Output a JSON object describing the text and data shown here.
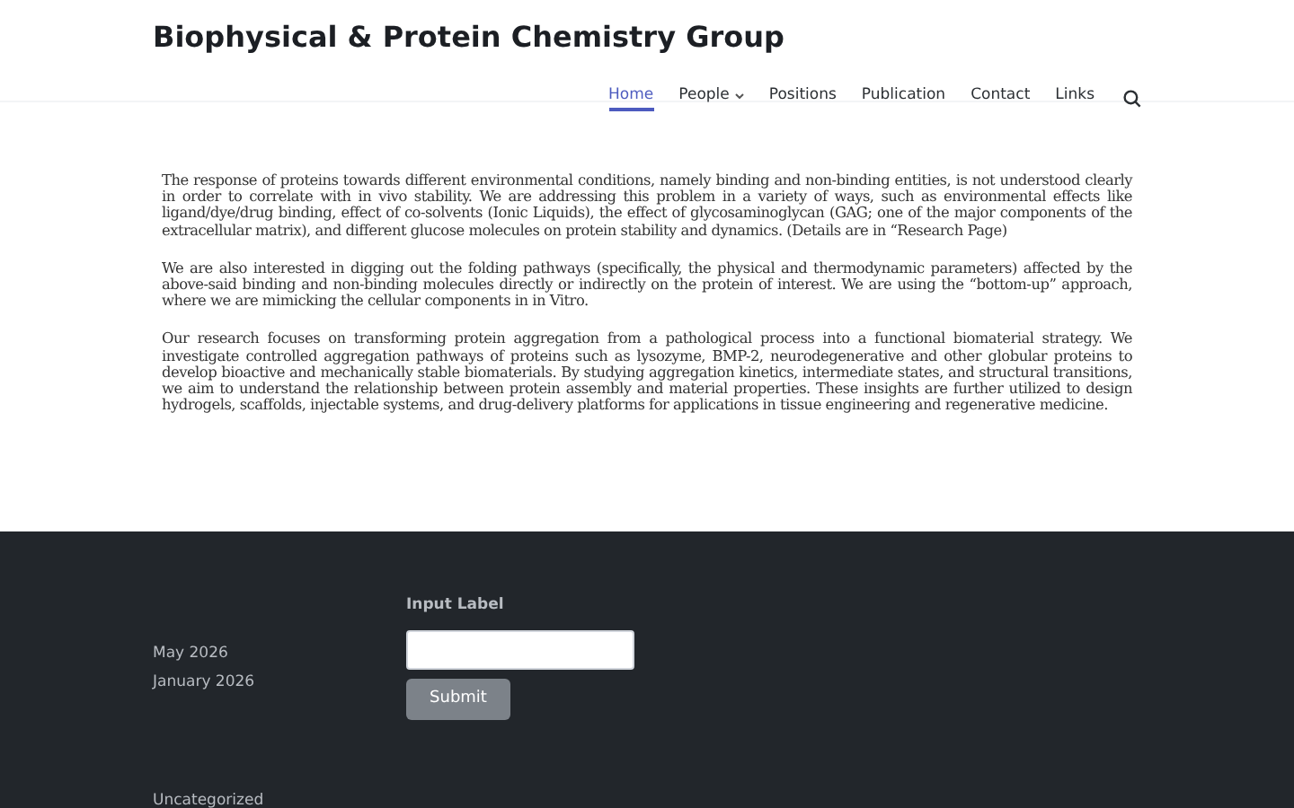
{
  "site_title": "Biophysical & Protein Chemistry Group",
  "nav": [
    {
      "label": "Home",
      "selected": true,
      "submenu": false
    },
    {
      "label": "People",
      "selected": false,
      "submenu": true
    },
    {
      "label": "Positions",
      "selected": false,
      "submenu": false
    },
    {
      "label": "Publication",
      "selected": false,
      "submenu": false
    },
    {
      "label": "Contact",
      "selected": false,
      "submenu": false
    },
    {
      "label": "Links",
      "selected": false,
      "submenu": false
    }
  ],
  "paragraphs": [
    "The response of proteins towards different environmental conditions, namely binding and non-binding entities, is not understood clearly in order to correlate with in vivo stability. We are addressing this problem in a variety of ways, such as environmental effects like ligand/dye/drug binding, effect of co-solvents (Ionic Liquids), the effect of glycosaminoglycan (GAG; one of the major components of the extracellular matrix), and different glucose molecules on protein stability and dynamics.  (Details are in “Research Page)",
    "We are also interested in digging out the folding pathways (specifically, the physical and thermodynamic parameters) affected by the above-said binding and non-binding molecules directly or indirectly on the protein of interest. We are using the “bottom-up” approach, where we are mimicking the cellular components in in Vitro.",
    "Our research focuses on transforming protein aggregation from a pathological process into a functional biomaterial strategy. We investigate controlled aggregation pathways of proteins such as lysozyme, BMP-2, neurodegenerative and other globular proteins to develop bioactive and mechanically stable biomaterials. By studying aggregation kinetics, intermediate states, and structural transitions, we aim to understand the relationship between protein assembly and material properties. These insights are further utilized to design hydrogels, scaffolds, injectable systems, and drug-delivery platforms for applications in tissue engineering and regenerative medicine."
  ],
  "footer": {
    "archives": [
      "May 2026",
      "January 2026"
    ],
    "form": {
      "label": "Input Label",
      "button": "Submit"
    },
    "categories": [
      "Uncategorized"
    ]
  }
}
